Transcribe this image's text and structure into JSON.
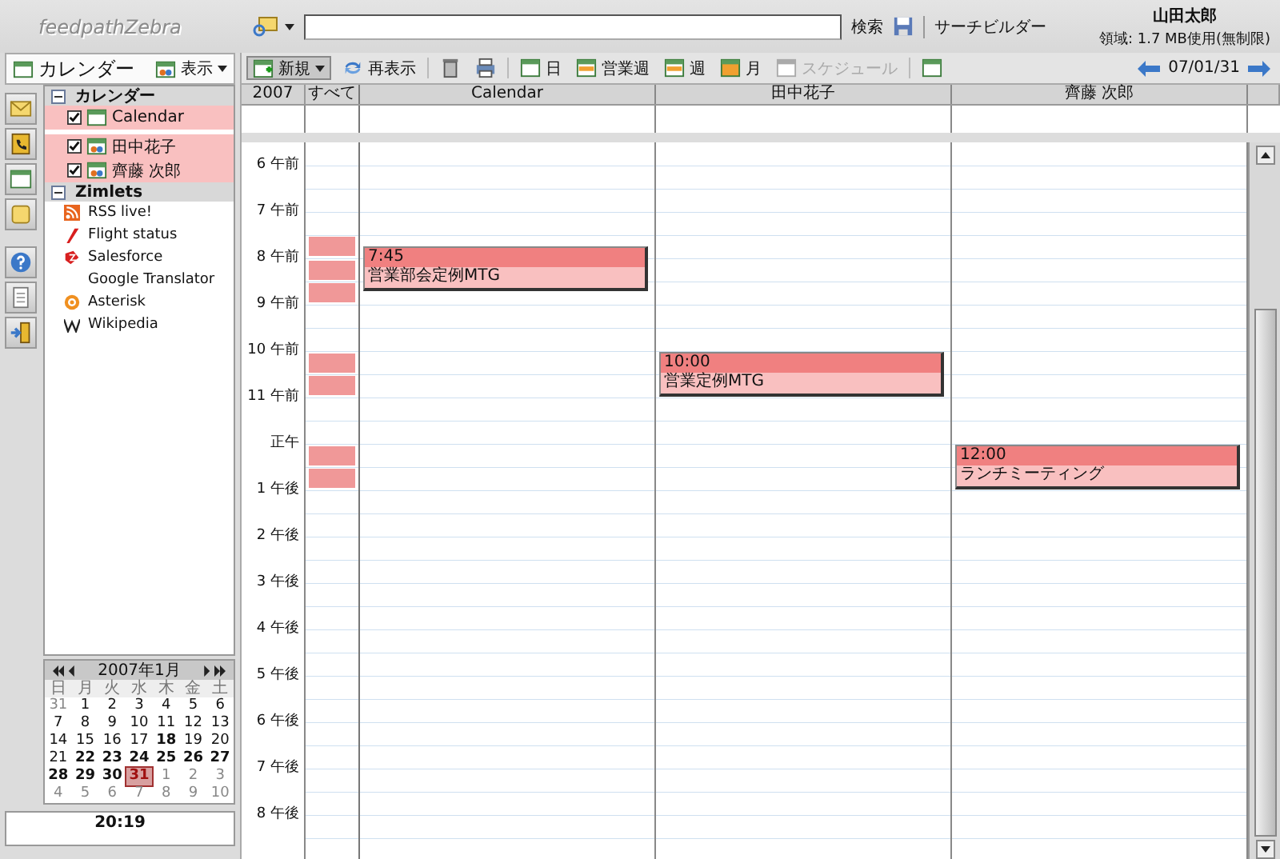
{
  "app": {
    "logo": "feedpathZebra"
  },
  "search": {
    "button": "検索",
    "builder": "サーチビルダー"
  },
  "user": {
    "name": "山田太郎",
    "quota": "領域: 1.7 MB使用(無制限)"
  },
  "panel": {
    "title": "カレンダー",
    "view": "表示"
  },
  "side_tabs": [
    {
      "kind": "mail"
    },
    {
      "kind": "contacts"
    },
    {
      "kind": "calendar"
    },
    {
      "kind": "notes"
    },
    {
      "kind": "help"
    },
    {
      "kind": "doc"
    },
    {
      "kind": "exit"
    }
  ],
  "tree": [
    {
      "label": "カレンダー",
      "expanded": true,
      "children": [
        {
          "label": "Calendar",
          "checked": true,
          "selected": true,
          "kind": "own"
        },
        {
          "label": "田中花子",
          "checked": true,
          "selected": true,
          "kind": "shared"
        },
        {
          "label": "齊藤 次郎",
          "checked": true,
          "selected": true,
          "kind": "shared"
        }
      ]
    },
    {
      "label": "Zimlets",
      "expanded": true,
      "children": [
        {
          "label": "RSS live!",
          "kind": "rss"
        },
        {
          "label": "Flight status",
          "kind": "flight"
        },
        {
          "label": "Salesforce",
          "kind": "salesforce"
        },
        {
          "label": "Google Translator",
          "kind": "none"
        },
        {
          "label": "Asterisk",
          "kind": "asterisk"
        },
        {
          "label": "Wikipedia",
          "kind": "wiki"
        }
      ]
    }
  ],
  "mini_calendar": {
    "title": "2007年1月",
    "weekdays": [
      "日",
      "月",
      "火",
      "水",
      "木",
      "金",
      "土"
    ],
    "weeks": [
      [
        {
          "day": "31",
          "kind": "other",
          "selected": false
        },
        {
          "day": "1",
          "kind": "normal",
          "selected": false
        },
        {
          "day": "2",
          "kind": "normal",
          "selected": false
        },
        {
          "day": "3",
          "kind": "normal",
          "selected": false
        },
        {
          "day": "4",
          "kind": "normal",
          "selected": false
        },
        {
          "day": "5",
          "kind": "normal",
          "selected": false
        },
        {
          "day": "6",
          "kind": "normal",
          "selected": false
        }
      ],
      [
        {
          "day": "7",
          "kind": "normal",
          "selected": false
        },
        {
          "day": "8",
          "kind": "normal",
          "selected": false
        },
        {
          "day": "9",
          "kind": "normal",
          "selected": false
        },
        {
          "day": "10",
          "kind": "normal",
          "selected": false
        },
        {
          "day": "11",
          "kind": "normal",
          "selected": false
        },
        {
          "day": "12",
          "kind": "normal",
          "selected": false
        },
        {
          "day": "13",
          "kind": "normal",
          "selected": false
        }
      ],
      [
        {
          "day": "14",
          "kind": "normal",
          "selected": false
        },
        {
          "day": "15",
          "kind": "normal",
          "selected": false
        },
        {
          "day": "16",
          "kind": "normal",
          "selected": false
        },
        {
          "day": "17",
          "kind": "normal",
          "selected": false
        },
        {
          "day": "18",
          "kind": "busy",
          "selected": false
        },
        {
          "day": "19",
          "kind": "normal",
          "selected": false
        },
        {
          "day": "20",
          "kind": "normal",
          "selected": false
        }
      ],
      [
        {
          "day": "21",
          "kind": "normal",
          "selected": false
        },
        {
          "day": "22",
          "kind": "busy",
          "selected": false
        },
        {
          "day": "23",
          "kind": "busy",
          "selected": false
        },
        {
          "day": "24",
          "kind": "busy",
          "selected": false
        },
        {
          "day": "25",
          "kind": "busy",
          "selected": false
        },
        {
          "day": "26",
          "kind": "busy",
          "selected": false
        },
        {
          "day": "27",
          "kind": "busy",
          "selected": false
        }
      ],
      [
        {
          "day": "28",
          "kind": "busy",
          "selected": false
        },
        {
          "day": "29",
          "kind": "busy",
          "selected": false
        },
        {
          "day": "30",
          "kind": "busy",
          "selected": false
        },
        {
          "day": "31",
          "kind": "busy",
          "selected": true
        },
        {
          "day": "1",
          "kind": "other",
          "selected": false
        },
        {
          "day": "2",
          "kind": "other",
          "selected": false
        },
        {
          "day": "3",
          "kind": "other",
          "selected": false
        }
      ],
      [
        {
          "day": "4",
          "kind": "other",
          "selected": false
        },
        {
          "day": "5",
          "kind": "other",
          "selected": false
        },
        {
          "day": "6",
          "kind": "other",
          "selected": false
        },
        {
          "day": "7",
          "kind": "other",
          "selected": false
        },
        {
          "day": "8",
          "kind": "other",
          "selected": false
        },
        {
          "day": "9",
          "kind": "other",
          "selected": false
        },
        {
          "day": "10",
          "kind": "other",
          "selected": false
        }
      ]
    ]
  },
  "clock": "20:19",
  "toolbar": [
    {
      "kind": "new",
      "label": "新規",
      "disabled": false
    },
    {
      "kind": "refresh",
      "label": "再表示",
      "disabled": false
    },
    {
      "kind": "delete"
    },
    {
      "kind": "print"
    },
    {
      "kind": "day",
      "label": "日",
      "disabled": false
    },
    {
      "kind": "workweek",
      "label": "営業週",
      "disabled": false
    },
    {
      "kind": "week",
      "label": "週",
      "disabled": false
    },
    {
      "kind": "month",
      "label": "月",
      "disabled": false
    },
    {
      "kind": "schedule",
      "label": "スケジュール",
      "disabled": true
    },
    {
      "kind": "today"
    }
  ],
  "date": "07/01/31",
  "grid": {
    "year": "2007",
    "all_label": "すべて",
    "hours": [
      "6 午前",
      "7 午前",
      "8 午前",
      "9 午前",
      "10 午前",
      "11 午前",
      "正午",
      "1 午後",
      "2 午後",
      "3 午後",
      "4 午後",
      "5 午後",
      "6 午後",
      "7 午後",
      "8 午後"
    ],
    "columns": [
      {
        "name": "Calendar",
        "events": [
          {
            "time": "7:45",
            "title": "営業部会定例MTG"
          }
        ]
      },
      {
        "name": "田中花子",
        "events": [
          {
            "time": "10:00",
            "title": "営業定例MTG"
          }
        ]
      },
      {
        "name": "齊藤 次郎",
        "events": [
          {
            "time": "12:00",
            "title": "ランチミーティング"
          }
        ]
      }
    ]
  }
}
